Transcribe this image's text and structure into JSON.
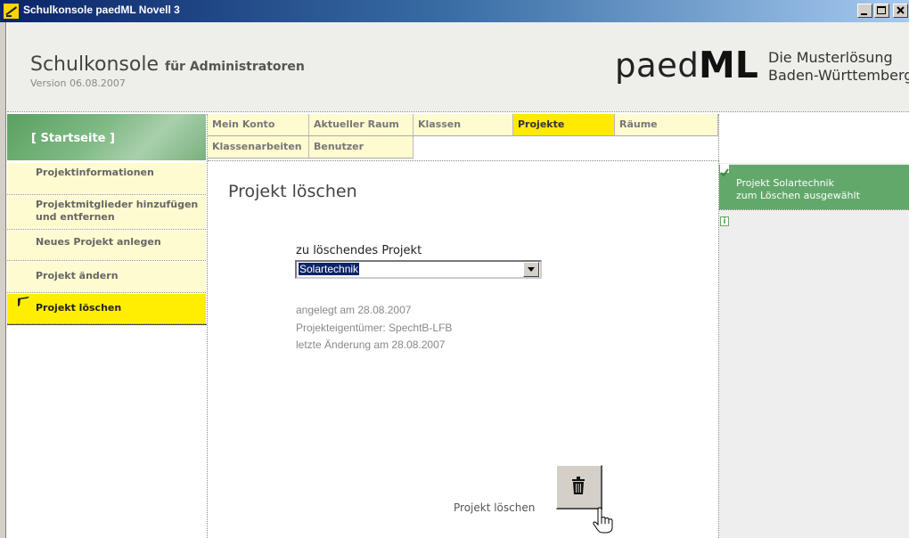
{
  "window": {
    "title": "Schulkonsole paedML Novell 3"
  },
  "header": {
    "app_name": "Schulkonsole",
    "app_sub": "für Administratoren",
    "version": "Version 06.08.2007",
    "logo_left": "paed",
    "logo_right": "ML",
    "tagline_1": "Die Musterlösung",
    "tagline_2": "Baden-Württemberg"
  },
  "start": {
    "label": "[ Startseite ]"
  },
  "nav": {
    "tabs": [
      {
        "label": "Mein Konto"
      },
      {
        "label": "Aktueller Raum"
      },
      {
        "label": "Klassen"
      },
      {
        "label": "Projekte"
      },
      {
        "label": "Räume"
      },
      {
        "label": "Klassenarbeiten"
      },
      {
        "label": "Benutzer"
      }
    ],
    "active": "Projekte"
  },
  "sidebar": {
    "items": [
      {
        "label": "Projektinformationen"
      },
      {
        "label": "Projektmitglieder hinzufügen und entfernen"
      },
      {
        "label": "Neues Projekt anlegen"
      },
      {
        "label": "Projekt ändern"
      },
      {
        "label": "Projekt löschen"
      }
    ],
    "active": "Projekt löschen"
  },
  "main": {
    "title": "Projekt löschen",
    "field_label": "zu löschendes Projekt",
    "selected_project": "Solartechnik",
    "info": [
      "angelegt am 28.08.2007",
      "Projekteigentümer: SpechtB-LFB",
      "letzte Änderung am 28.08.2007"
    ],
    "delete_label": "Projekt löschen"
  },
  "notice": {
    "line_1": "Projekt Solartechnik",
    "line_2": "zum Löschen ausgewählt"
  },
  "colors": {
    "accent_green": "#62a86b",
    "tab_bg": "#fffbd0",
    "active_yellow": "#ffea00",
    "titlebar_start": "#0a246a"
  },
  "icons": [
    "app-icon",
    "minimize-icon",
    "maximize-icon",
    "close-icon",
    "edit-pencil-icon",
    "trash-icon",
    "check-icon",
    "info-icon",
    "hand-cursor-icon"
  ]
}
